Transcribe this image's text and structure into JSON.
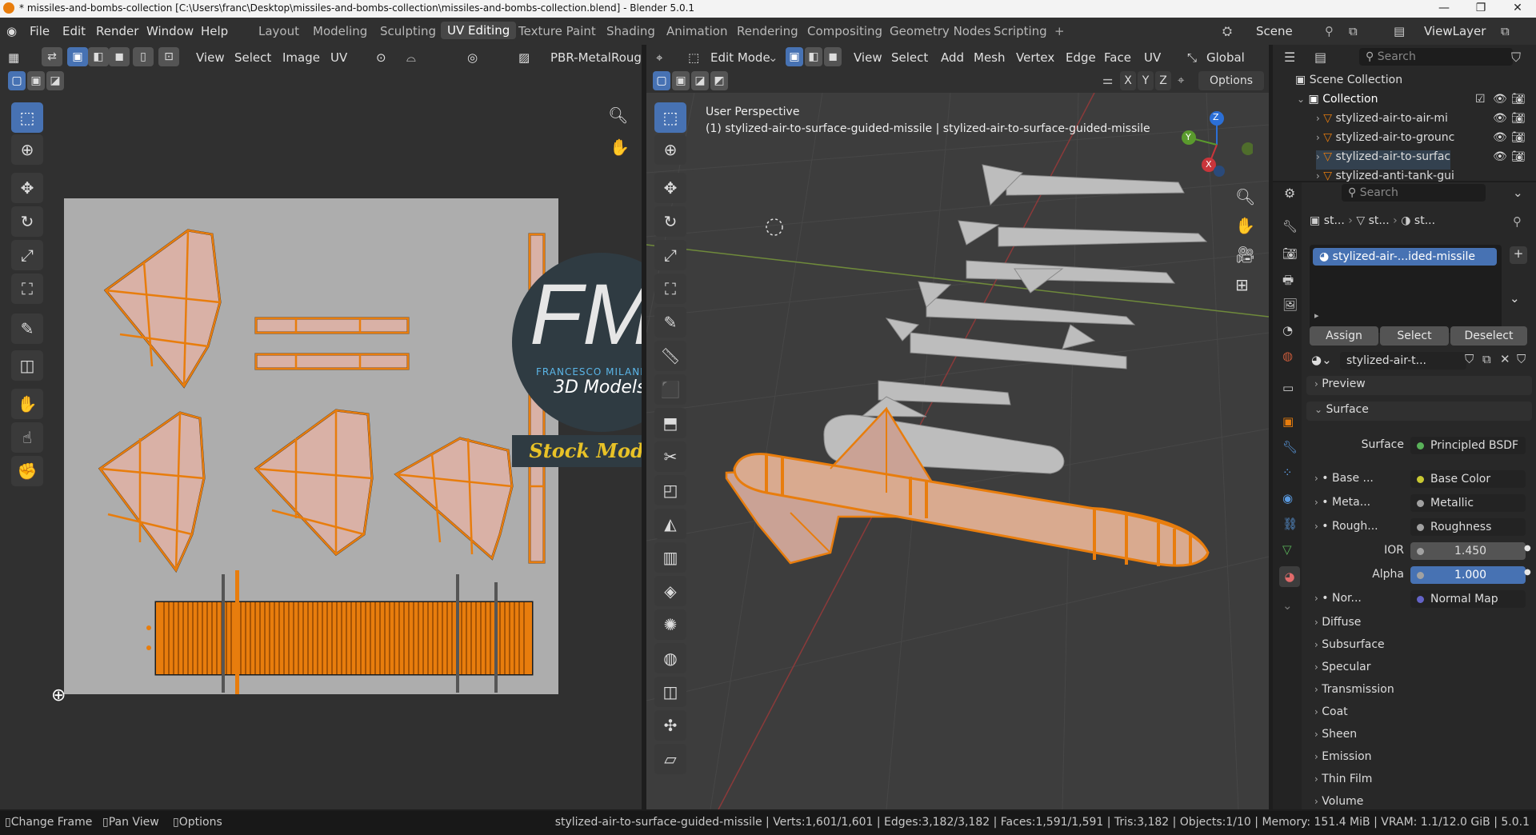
{
  "titlebar": {
    "title": "* missiles-and-bombs-collection [C:\\Users\\franc\\Desktop\\missiles-and-bombs-collection\\missiles-and-bombs-collection.blend] - Blender 5.0.1",
    "minimize": "—",
    "maximize": "❐",
    "close": "✕"
  },
  "menu": [
    "File",
    "Edit",
    "Render",
    "Window",
    "Help"
  ],
  "workspaces": [
    "Layout",
    "Modeling",
    "Sculpting",
    "UV Editing",
    "Texture Paint",
    "Shading",
    "Animation",
    "Rendering",
    "Compositing",
    "Geometry Nodes",
    "Scripting"
  ],
  "add_workspace": "+",
  "scene": {
    "label": "Scene",
    "viewlayer": "ViewLayer"
  },
  "uv_editor": {
    "menus": [
      "View",
      "Select",
      "Image",
      "UV"
    ],
    "image_name": "PBR-MetalRoug"
  },
  "viewport": {
    "mode": "Edit Mode",
    "menus": [
      "View",
      "Select",
      "Add",
      "Mesh",
      "Vertex",
      "Edge",
      "Face",
      "UV"
    ],
    "transform": "Global",
    "axes": [
      "X",
      "Y",
      "Z"
    ],
    "options": "Options",
    "overlay_title": "User Perspective",
    "overlay_object": "(1) stylized-air-to-surface-guided-missile | stylized-air-to-surface-guided-missile",
    "gizmo": {
      "x": "X",
      "y": "Y",
      "z": "Z"
    }
  },
  "watermark": {
    "letters": "FM",
    "name": "FRANCESCO MILANESE",
    "subtitle": "3D Models",
    "banner": "Stock Models"
  },
  "outliner": {
    "search_placeholder": "Search",
    "scene_collection": "Scene Collection",
    "collection": "Collection",
    "items": [
      "stylized-air-to-air-mi",
      "stylized-air-to-grounc",
      "stylized-air-to-surfac",
      "stylized-anti-tank-gui"
    ]
  },
  "properties": {
    "search_placeholder": "Search",
    "breadcrumb": [
      "st...",
      "st...",
      "st..."
    ],
    "material_slot": "stylized-air-...ided-missile",
    "buttons": [
      "Assign",
      "Select",
      "Deselect"
    ],
    "material_name": "stylized-air-t...",
    "panels": {
      "preview": "Preview",
      "surface": "Surface"
    },
    "surface_label": "Surface",
    "surface_value": "Principled BSDF",
    "inputs": [
      {
        "label": "Base ...",
        "value": "Base Color",
        "dot": "#c8c832"
      },
      {
        "label": "Meta...",
        "value": "Metallic",
        "dot": "#a1a1a1"
      },
      {
        "label": "Rough...",
        "value": "Roughness",
        "dot": "#a1a1a1"
      }
    ],
    "ior": {
      "label": "IOR",
      "value": "1.450"
    },
    "alpha": {
      "label": "Alpha",
      "value": "1.000"
    },
    "normal": {
      "label": "Nor...",
      "value": "Normal Map",
      "dot": "#6363c7"
    },
    "sections": [
      "Diffuse",
      "Subsurface",
      "Specular",
      "Transmission",
      "Coat",
      "Sheen",
      "Emission",
      "Thin Film",
      "Volume"
    ]
  },
  "statusbar": {
    "left": [
      "Change Frame",
      "Pan View",
      "Options"
    ],
    "info": "stylized-air-to-surface-guided-missile | Verts:1,601/1,601 | Edges:3,182/3,182 | Faces:1,591/1,591 | Tris:3,182 | Objects:1/10 | Memory: 151.4 MiB | VRAM: 1.1/12.0 GiB | 5.0.1"
  },
  "colors": {
    "accent": "#4772b3",
    "selection": "#e87d0d",
    "uv_bg": "#adadad",
    "uv_face": "#d9b1a6",
    "viewport_bg": "#3d3d3d"
  }
}
